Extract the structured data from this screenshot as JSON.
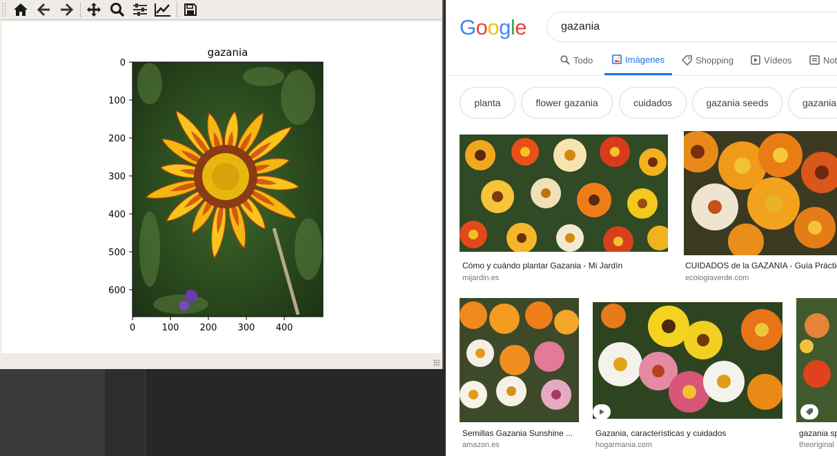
{
  "matplotlib": {
    "toolbar": [
      "home-icon",
      "back-icon",
      "forward-icon",
      "pan-icon",
      "zoom-icon",
      "configure-subplots-icon",
      "edit-axes-icon",
      "save-icon"
    ],
    "plot_title": "gazania",
    "y_ticks": [
      "0",
      "100",
      "200",
      "300",
      "400",
      "500",
      "600"
    ],
    "x_ticks": [
      "0",
      "100",
      "200",
      "300",
      "400"
    ]
  },
  "google": {
    "logo": [
      "G",
      "o",
      "o",
      "g",
      "l",
      "e"
    ],
    "logo_colors": [
      "#4285F4",
      "#EA4335",
      "#FBBC05",
      "#4285F4",
      "#34A853",
      "#EA4335"
    ],
    "search_value": "gazania",
    "accent_color": "#1a73e8",
    "tabs": [
      {
        "label": "Todo",
        "icon": "search-icon"
      },
      {
        "label": "Imágenes",
        "icon": "image-icon",
        "active": true
      },
      {
        "label": "Shopping",
        "icon": "tag-icon"
      },
      {
        "label": "Vídeos",
        "icon": "play-icon"
      },
      {
        "label": "Not",
        "icon": "news-icon"
      }
    ],
    "chips": [
      "planta",
      "flower gazania",
      "cuidados",
      "gazania seeds",
      "gazania"
    ],
    "results": [
      {
        "title": "Cómo y cuándo plantar Gazania - Mi Jardín",
        "site": "mijardin.es"
      },
      {
        "title": "CUIDADOS de la GAZANIA - Guía Práctic",
        "site": "ecologiaverde.com"
      },
      {
        "title": "Semillas Gazania Sunshine ...",
        "site": "amazon.es"
      },
      {
        "title": "Gazania, características y cuidados",
        "site": "hogarmania.com"
      },
      {
        "title": "gazania sp",
        "site": "theoriginal"
      }
    ]
  }
}
